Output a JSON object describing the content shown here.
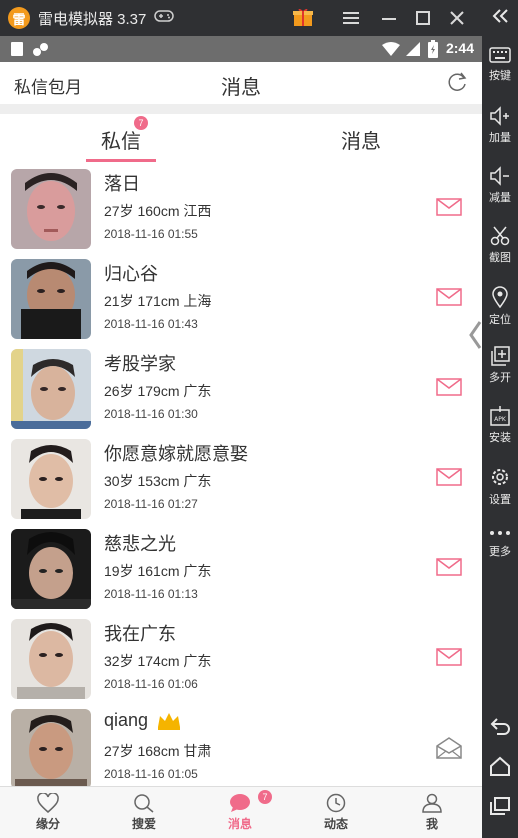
{
  "emulator": {
    "title": "雷电模拟器 3.37",
    "sidebar": [
      {
        "label": "按键",
        "icon": "keyboard-icon"
      },
      {
        "label": "加量",
        "icon": "volume-up-icon"
      },
      {
        "label": "减量",
        "icon": "volume-down-icon"
      },
      {
        "label": "截图",
        "icon": "scissors-icon"
      },
      {
        "label": "定位",
        "icon": "location-pin-icon"
      },
      {
        "label": "多开",
        "icon": "multi-open-icon"
      },
      {
        "label": "安装",
        "icon": "apk-install-icon"
      },
      {
        "label": "设置",
        "icon": "gear-icon"
      },
      {
        "label": "更多",
        "icon": "more-dots-icon"
      }
    ]
  },
  "statusbar": {
    "time": "2:44"
  },
  "header": {
    "left": "私信包月",
    "title": "消息"
  },
  "tabs": [
    {
      "label": "私信",
      "badge": "7",
      "active": true
    },
    {
      "label": "消息",
      "active": false
    }
  ],
  "messages": [
    {
      "nick": "落日",
      "info": "27岁  160cm  江西",
      "time": "2018-11-16 01:55",
      "read": false,
      "vip": false
    },
    {
      "nick": "归心谷",
      "info": "21岁  171cm  上海",
      "time": "2018-11-16 01:43",
      "read": false,
      "vip": false
    },
    {
      "nick": "考股学家",
      "info": "26岁  179cm  广东",
      "time": "2018-11-16 01:30",
      "read": false,
      "vip": false
    },
    {
      "nick": "你愿意嫁就愿意娶",
      "info": "30岁  153cm  广东",
      "time": "2018-11-16 01:27",
      "read": false,
      "vip": false
    },
    {
      "nick": "慈悲之光",
      "info": "19岁  161cm  广东",
      "time": "2018-11-16 01:13",
      "read": false,
      "vip": false
    },
    {
      "nick": "我在广东",
      "info": "32岁  174cm  广东",
      "time": "2018-11-16 01:06",
      "read": false,
      "vip": false
    },
    {
      "nick": "qiang",
      "info": "27岁  168cm  甘肃",
      "time": "2018-11-16 01:05",
      "read": true,
      "vip": true
    }
  ],
  "bottomnav": [
    {
      "label": "缘分",
      "icon": "heart-icon",
      "active": false
    },
    {
      "label": "搜爱",
      "icon": "search-icon",
      "active": false
    },
    {
      "label": "消息",
      "icon": "chat-bubble-icon",
      "active": true,
      "badge": "7"
    },
    {
      "label": "动态",
      "icon": "clock-icon",
      "active": false
    },
    {
      "label": "我",
      "icon": "person-icon",
      "active": false
    }
  ],
  "colors": {
    "accent": "#f06b8a",
    "emulator_bg": "#2f3033",
    "statusbar": "#6d6d6d"
  }
}
